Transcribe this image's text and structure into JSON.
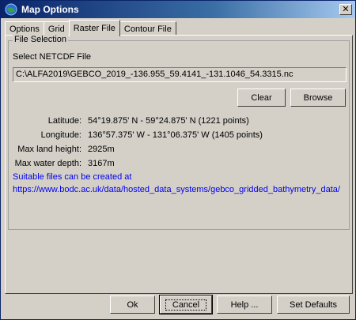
{
  "window": {
    "title": "Map Options",
    "close_symbol": "✕"
  },
  "tabs": [
    {
      "label": "Options",
      "active": false
    },
    {
      "label": "Grid",
      "active": false
    },
    {
      "label": "Raster File",
      "active": true
    },
    {
      "label": "Contour File",
      "active": false
    }
  ],
  "file_selection": {
    "legend": "File Selection",
    "select_label": "Select NETCDF File",
    "path": "C:\\ALFA2019\\GEBCO_2019_-136.955_59.4141_-131.1046_54.3315.nc",
    "clear_label": "Clear",
    "browse_label": "Browse"
  },
  "info": [
    {
      "label": "Latitude:",
      "value": "54°19.875' N - 59°24.875' N (1221 points)"
    },
    {
      "label": "Longitude:",
      "value": "136°57.375' W - 131°06.375' W (1405 points)"
    },
    {
      "label": "Max land height:",
      "value": "2925m"
    },
    {
      "label": "Max water depth:",
      "value": "3167m"
    }
  ],
  "note": {
    "line1": "Suitable files can be created at",
    "line2": "https://www.bodc.ac.uk/data/hosted_data_systems/gebco_gridded_bathymetry_data/"
  },
  "footer": {
    "ok_label": "Ok",
    "cancel_label": "Cancel",
    "help_label": "Help ...",
    "defaults_label": "Set Defaults"
  },
  "colors": {
    "titlebar_start": "#0a246a",
    "titlebar_end": "#a6caf0",
    "link": "#0000ee",
    "face": "#d4d0c8"
  }
}
